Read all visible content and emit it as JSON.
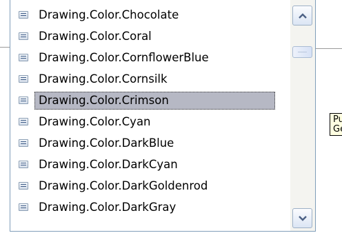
{
  "completion_list": {
    "items": [
      {
        "label": "Drawing.Color.Chocolate"
      },
      {
        "label": "Drawing.Color.Coral"
      },
      {
        "label": "Drawing.Color.CornflowerBlue"
      },
      {
        "label": "Drawing.Color.Cornsilk"
      },
      {
        "label": "Drawing.Color.Crimson",
        "selected": true
      },
      {
        "label": "Drawing.Color.Cyan"
      },
      {
        "label": "Drawing.Color.DarkBlue"
      },
      {
        "label": "Drawing.Color.DarkCyan"
      },
      {
        "label": "Drawing.Color.DarkGoldenrod"
      },
      {
        "label": "Drawing.Color.DarkGray"
      }
    ],
    "item_icon": "property-icon",
    "selected_index": 4
  },
  "scrollbar": {
    "up_icon": "arrow-up-icon",
    "down_icon": "arrow-down-icon"
  },
  "tooltip": {
    "line1": "Pu",
    "line2": "Ge"
  },
  "colors": {
    "selection": "#b6b8c4",
    "tooltip_bg": "#ffffe1",
    "border": "#7f9db9"
  }
}
